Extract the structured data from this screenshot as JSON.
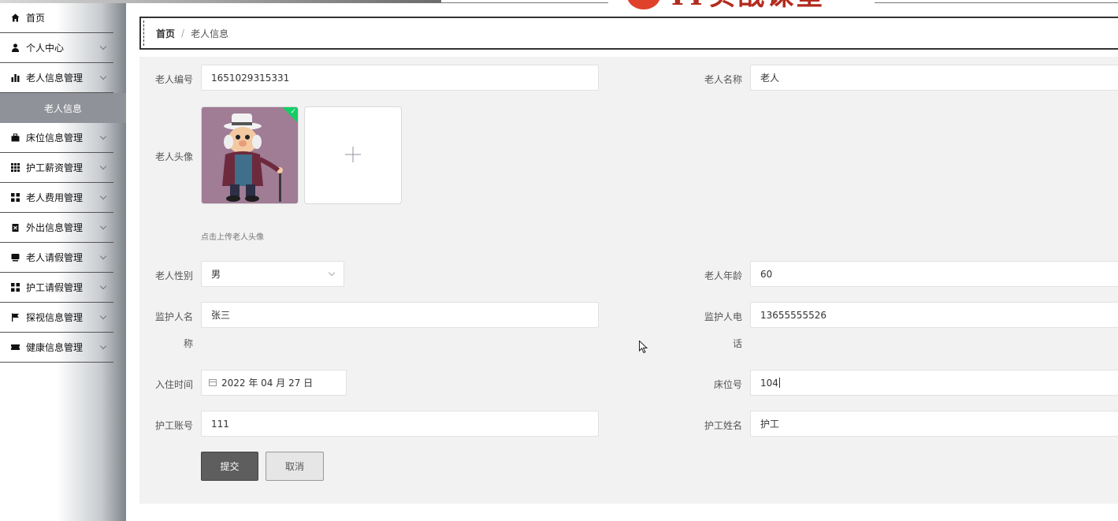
{
  "brand": {
    "text": "IT实战课堂"
  },
  "sidebar": {
    "items": [
      {
        "label": "首页",
        "icon": "home-icon"
      },
      {
        "label": "个人中心",
        "icon": "user-icon"
      },
      {
        "label": "老人信息管理",
        "icon": "bar-chart-icon"
      },
      {
        "label": "床位信息管理",
        "icon": "briefcase-icon"
      },
      {
        "label": "护工薪资管理",
        "icon": "grid-icon"
      },
      {
        "label": "老人费用管理",
        "icon": "apps-icon"
      },
      {
        "label": "外出信息管理",
        "icon": "clipboard-icon"
      },
      {
        "label": "老人请假管理",
        "icon": "inbox-icon"
      },
      {
        "label": "护工请假管理",
        "icon": "apps-icon"
      },
      {
        "label": "探视信息管理",
        "icon": "flag-icon"
      },
      {
        "label": "健康信息管理",
        "icon": "ticket-icon"
      }
    ],
    "active_sub": "老人信息"
  },
  "breadcrumb": {
    "home": "首页",
    "separator": "/",
    "current": "老人信息"
  },
  "form": {
    "elder_id": {
      "label": "老人编号",
      "value": "1651029315331"
    },
    "elder_name": {
      "label": "老人名称",
      "value": "老人"
    },
    "avatar": {
      "label": "老人头像",
      "hint": "点击上传老人头像"
    },
    "gender": {
      "label": "老人性别",
      "value": "男"
    },
    "age": {
      "label": "老人年龄",
      "value": "60"
    },
    "guardian_name": {
      "label_line1": "监护人名",
      "label_line2": "称",
      "value": "张三"
    },
    "guardian_phone": {
      "label_line1": "监护人电",
      "label_line2": "话",
      "value": "13655555526"
    },
    "checkin_date": {
      "label": "入住时间",
      "value": "2022 年 04 月 27 日"
    },
    "bed_no": {
      "label": "床位号",
      "value": "104"
    },
    "nurse_account": {
      "label": "护工账号",
      "value": "111"
    },
    "nurse_name": {
      "label": "护工姓名",
      "value": "护工"
    },
    "submit_label": "提交",
    "cancel_label": "取消"
  },
  "colors": {
    "accent_submit": "#5e5e5e",
    "success_badge": "#13ce66",
    "panel_bg": "#f2f2f2"
  }
}
